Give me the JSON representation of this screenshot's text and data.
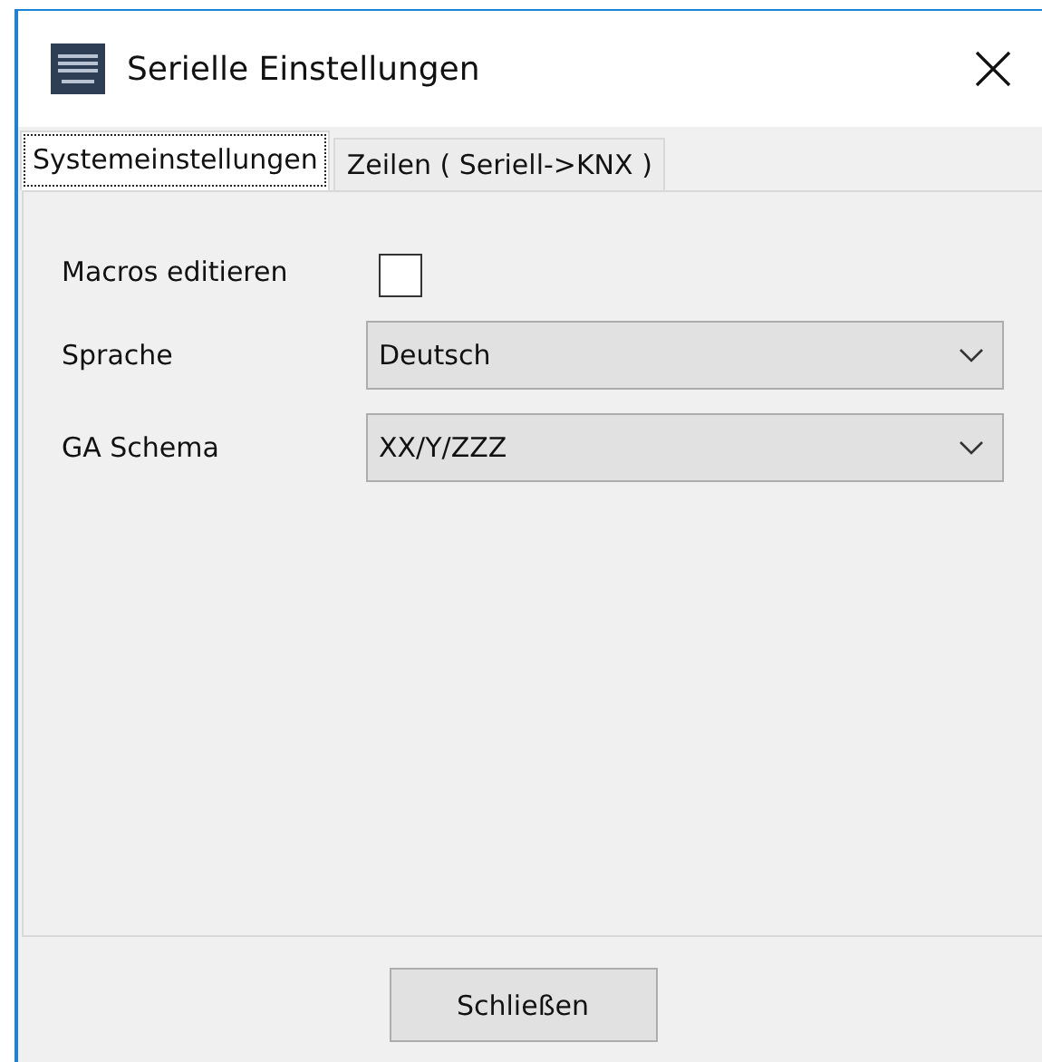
{
  "window": {
    "title": "Serielle Einstellungen"
  },
  "tabs": [
    {
      "label": "Systemeinstellungen",
      "selected": true
    },
    {
      "label": "Zeilen ( Seriell->KNX )",
      "selected": false
    }
  ],
  "fields": [
    {
      "kind": "checkbox",
      "label": "Macros editieren",
      "checked": false
    },
    {
      "kind": "select",
      "label": "Sprache",
      "value": "Deutsch"
    },
    {
      "kind": "select",
      "label": "GA Schema",
      "value": "XX/Y/ZZZ"
    }
  ],
  "buttons": [
    "Schließen"
  ]
}
